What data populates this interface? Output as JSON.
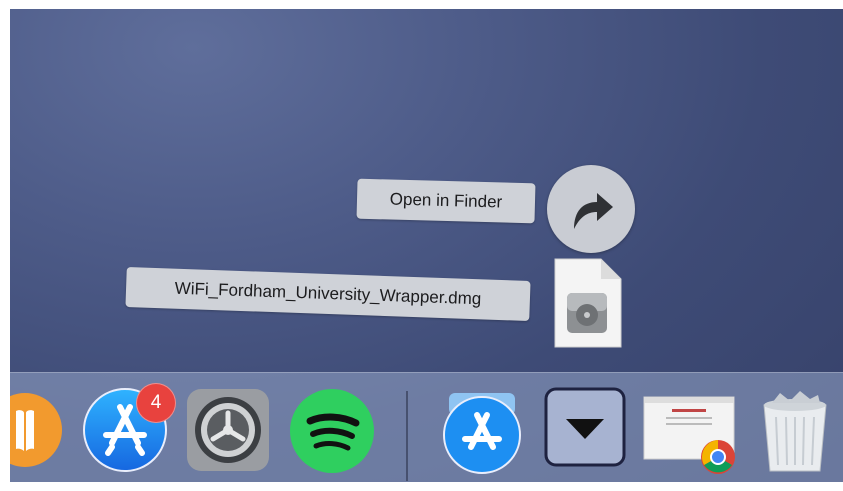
{
  "stack": {
    "open_in_finder_label": "Open in Finder",
    "file_name": "WiFi_Fordham_University_Wrapper.dmg"
  },
  "dock": {
    "apps": [
      {
        "icon": "books-icon"
      },
      {
        "icon": "app-store-icon",
        "badge": "4"
      },
      {
        "icon": "system-preferences-icon"
      },
      {
        "icon": "spotify-icon"
      },
      {
        "icon": "applications-folder-icon"
      },
      {
        "icon": "downloads-stack-icon"
      },
      {
        "icon": "chrome-window-thumbnail-icon"
      },
      {
        "icon": "trash-icon"
      }
    ]
  },
  "colors": {
    "desktop": "#44507d",
    "badge": "#e8423e",
    "spotify": "#2fcf5f",
    "appstore": "#1d8ff2"
  }
}
